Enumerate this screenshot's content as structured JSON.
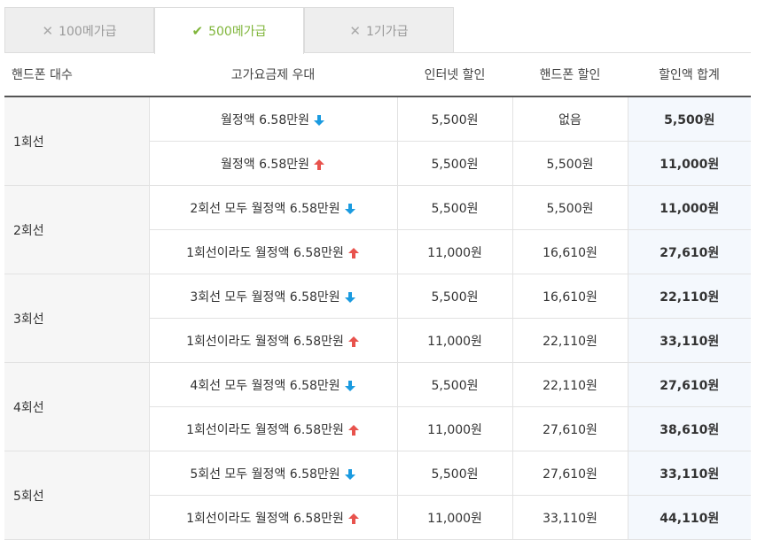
{
  "tabs": [
    {
      "label": "100메가급",
      "icon": "x-mark-icon",
      "active": false
    },
    {
      "label": "500메가급",
      "icon": "check-mark-icon",
      "active": true
    },
    {
      "label": "1기가급",
      "icon": "x-mark-icon",
      "active": false
    }
  ],
  "table": {
    "headers": [
      "핸드폰 대수",
      "고가요금제 우대",
      "인터넷 할인",
      "핸드폰 할인",
      "할인액 합계"
    ],
    "groups": [
      {
        "label": "1회선",
        "rows": [
          {
            "condition": "월정액 6.58만원",
            "direction": "down",
            "internet": "5,500원",
            "phone": "없음",
            "total": "5,500원"
          },
          {
            "condition": "월정액 6.58만원",
            "direction": "up",
            "internet": "5,500원",
            "phone": "5,500원",
            "total": "11,000원"
          }
        ]
      },
      {
        "label": "2회선",
        "rows": [
          {
            "condition": "2회선 모두 월정액 6.58만원",
            "direction": "down",
            "internet": "5,500원",
            "phone": "5,500원",
            "total": "11,000원"
          },
          {
            "condition": "1회선이라도 월정액 6.58만원",
            "direction": "up",
            "internet": "11,000원",
            "phone": "16,610원",
            "total": "27,610원"
          }
        ]
      },
      {
        "label": "3회선",
        "rows": [
          {
            "condition": "3회선 모두 월정액 6.58만원",
            "direction": "down",
            "internet": "5,500원",
            "phone": "16,610원",
            "total": "22,110원"
          },
          {
            "condition": "1회선이라도 월정액 6.58만원",
            "direction": "up",
            "internet": "11,000원",
            "phone": "22,110원",
            "total": "33,110원"
          }
        ]
      },
      {
        "label": "4회선",
        "rows": [
          {
            "condition": "4회선 모두 월정액 6.58만원",
            "direction": "down",
            "internet": "5,500원",
            "phone": "22,110원",
            "total": "27,610원"
          },
          {
            "condition": "1회선이라도 월정액 6.58만원",
            "direction": "up",
            "internet": "11,000원",
            "phone": "27,610원",
            "total": "38,610원"
          }
        ]
      },
      {
        "label": "5회선",
        "rows": [
          {
            "condition": "5회선 모두 월정액 6.58만원",
            "direction": "down",
            "internet": "5,500원",
            "phone": "27,610원",
            "total": "33,110원"
          },
          {
            "condition": "1회선이라도 월정액 6.58만원",
            "direction": "up",
            "internet": "11,000원",
            "phone": "33,110원",
            "total": "44,110원"
          }
        ]
      }
    ]
  },
  "colors": {
    "arrow_down": "#1b9be0",
    "arrow_up": "#e8534d",
    "active_tab": "#7fb539"
  }
}
